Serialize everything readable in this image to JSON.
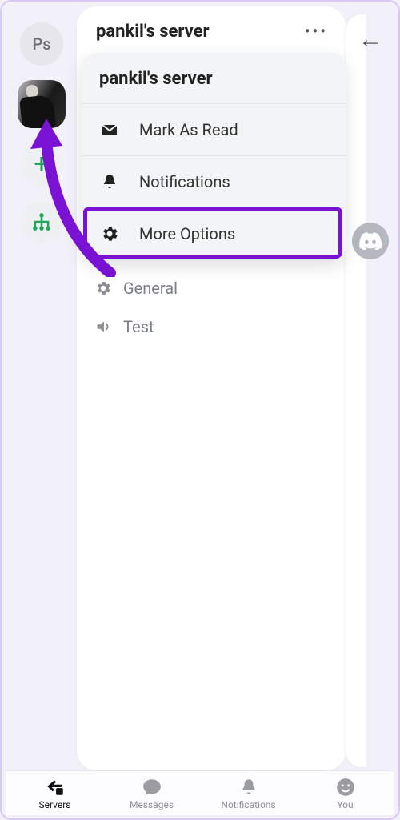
{
  "rail": {
    "ps_label": "Ps",
    "add_glyph": "+"
  },
  "header": {
    "title": "pankil's server",
    "more_glyph": "•••"
  },
  "dropdown": {
    "title": "pankil's server",
    "mark_read": "Mark As Read",
    "notifications": "Notifications",
    "more_options": "More Options"
  },
  "channels": {
    "general": "General",
    "test": "Test"
  },
  "right": {
    "back_glyph": "←"
  },
  "tabs": {
    "servers": "Servers",
    "messages": "Messages",
    "notifications": "Notifications",
    "you": "You"
  }
}
